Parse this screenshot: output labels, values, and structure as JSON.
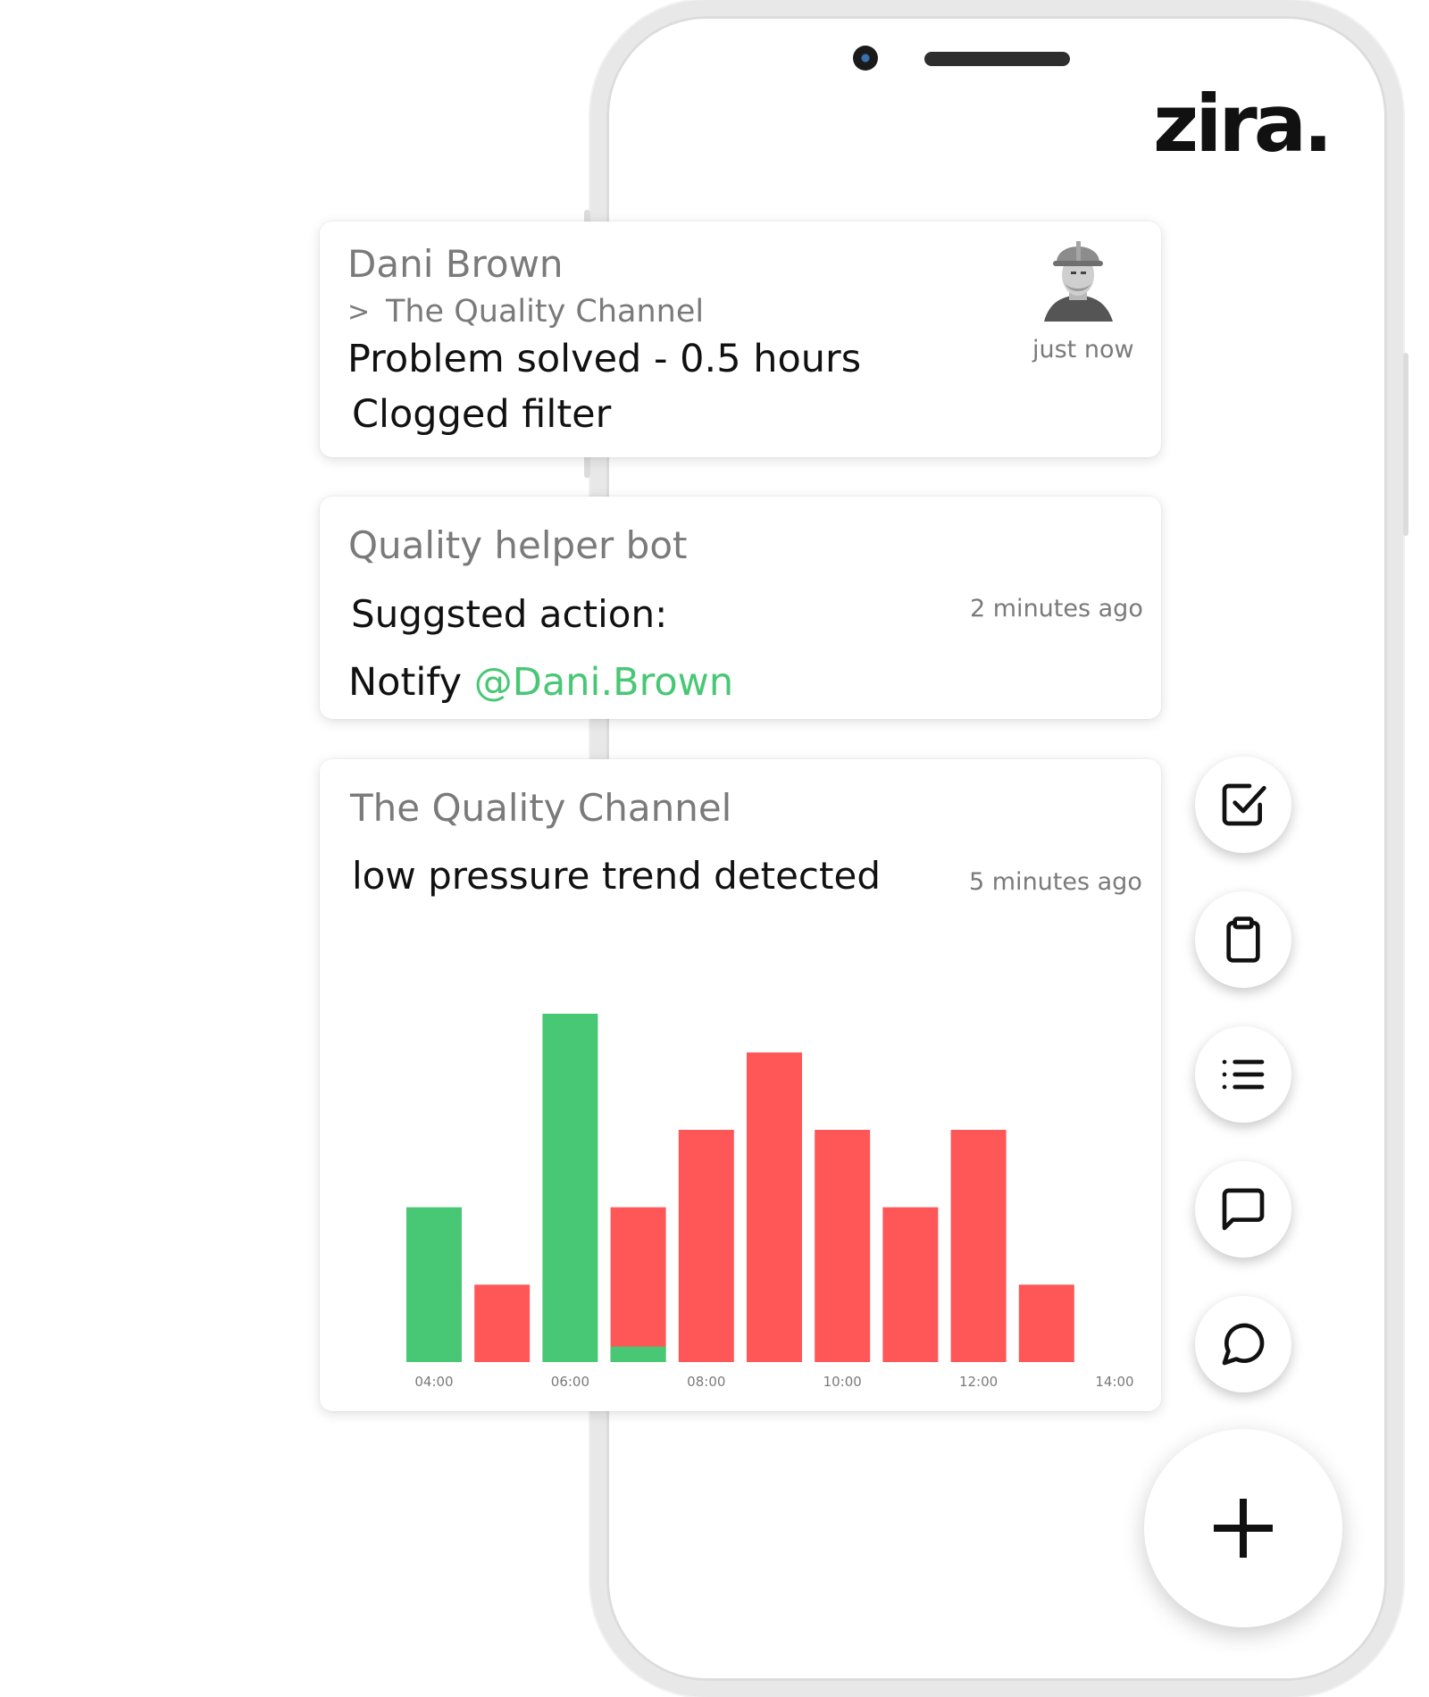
{
  "app": {
    "logo": "zira."
  },
  "feed": [
    {
      "author": "Dani Brown",
      "channel_prefix": ">",
      "channel": "The Quality Channel",
      "line1": "Problem solved - 0.5 hours",
      "line2": "Clogged filter",
      "time": "just now"
    },
    {
      "author": "Quality helper bot",
      "line1": "Suggsted action:",
      "line2_prefix": "Notify",
      "mention": "@Dani.Brown",
      "time": "2 minutes ago"
    },
    {
      "author": "The Quality Channel",
      "line1": "low pressure trend detected",
      "time": "5 minutes ago"
    }
  ],
  "actions": [
    {
      "icon": "checkbox-icon"
    },
    {
      "icon": "clipboard-icon"
    },
    {
      "icon": "list-icon"
    },
    {
      "icon": "message-square-icon"
    },
    {
      "icon": "message-circle-icon"
    },
    {
      "icon": "plus-icon"
    }
  ],
  "colors": {
    "green": "#48c774",
    "red": "#ff5757",
    "mention": "#48c774"
  },
  "chart_data": {
    "type": "bar",
    "x_ticks": [
      "04:00",
      "06:00",
      "08:00",
      "10:00",
      "12:00",
      "14:00"
    ],
    "ylim": [
      0,
      9
    ],
    "bars": [
      {
        "x": "04:00",
        "value": 4,
        "color": "green"
      },
      {
        "x": "05:00",
        "value": 2,
        "color": "red"
      },
      {
        "x": "06:00",
        "value": 9,
        "color": "green"
      },
      {
        "x": "07:00",
        "value": 4,
        "color": "red",
        "green_base": 0.4
      },
      {
        "x": "08:00",
        "value": 6,
        "color": "red"
      },
      {
        "x": "09:00",
        "value": 8,
        "color": "red"
      },
      {
        "x": "10:00",
        "value": 6,
        "color": "red"
      },
      {
        "x": "11:00",
        "value": 4,
        "color": "red"
      },
      {
        "x": "12:00",
        "value": 6,
        "color": "red"
      },
      {
        "x": "13:00",
        "value": 2,
        "color": "red"
      }
    ]
  }
}
